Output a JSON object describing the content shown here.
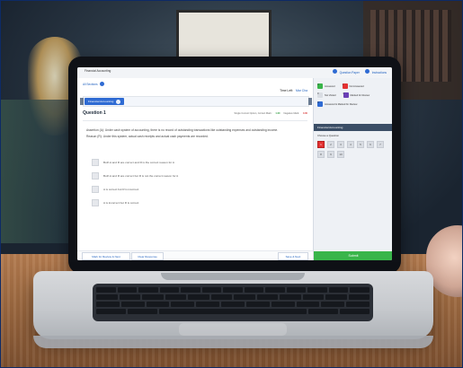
{
  "app": {
    "title": "Financial Accounting"
  },
  "top_links": {
    "question_paper": "Question Paper",
    "instructions": "Instructions"
  },
  "header": {
    "sections_label": "All Sections",
    "time_left_label": "Time Left:",
    "time_left_value": "Mar Cha"
  },
  "section": {
    "tab_label": "Financial Accounting"
  },
  "question": {
    "title": "Question 1",
    "meta": {
      "prefix": "Single Correct Option, Correct Mark:",
      "positive": "1.00",
      "negative_label": "Negative Mark:",
      "negative": "0.00"
    },
    "stem": [
      "Assertion (A): Under cash system of accounting, there is no record of outstanding transactions like outstanding expenses and outstanding income.",
      "Reason (R): Under this system, actual cash receipts and actual cash payments are recorded."
    ],
    "options": [
      "Both A and R are correct and R is the correct reason for A",
      "Both A and R are correct but R is not the correct reason for A",
      "A is correct but R is incorrect",
      "A is incorrect but R is correct"
    ]
  },
  "actions": {
    "mark_review": "Mark for Review & Next",
    "clear_response": "Clear Response",
    "save_next": "Save & Next",
    "submit": "Submit"
  },
  "side": {
    "legend": [
      {
        "count": "0",
        "label": "Answered",
        "color": "#39b54a"
      },
      {
        "count": "1",
        "label": "Not Answered",
        "color": "#e33232"
      },
      {
        "count": "0",
        "label": "Not Visited",
        "color": "#d9dde3"
      },
      {
        "count": "0",
        "label": "Marked for Review",
        "color": "#6a3fb6"
      },
      {
        "count": "0",
        "label": "Answered & Marked for Review",
        "color": "#2f6bd3"
      }
    ],
    "section_title": "Financial Accounting",
    "choose_label": "Choose a Question",
    "palette": [
      "1",
      "2",
      "3",
      "4",
      "5",
      "6",
      "7",
      "8",
      "9",
      "10"
    ]
  },
  "colors": {
    "brand_blue": "#2f6bd3",
    "submit_green": "#39b54a",
    "not_answered_red": "#e33232"
  }
}
